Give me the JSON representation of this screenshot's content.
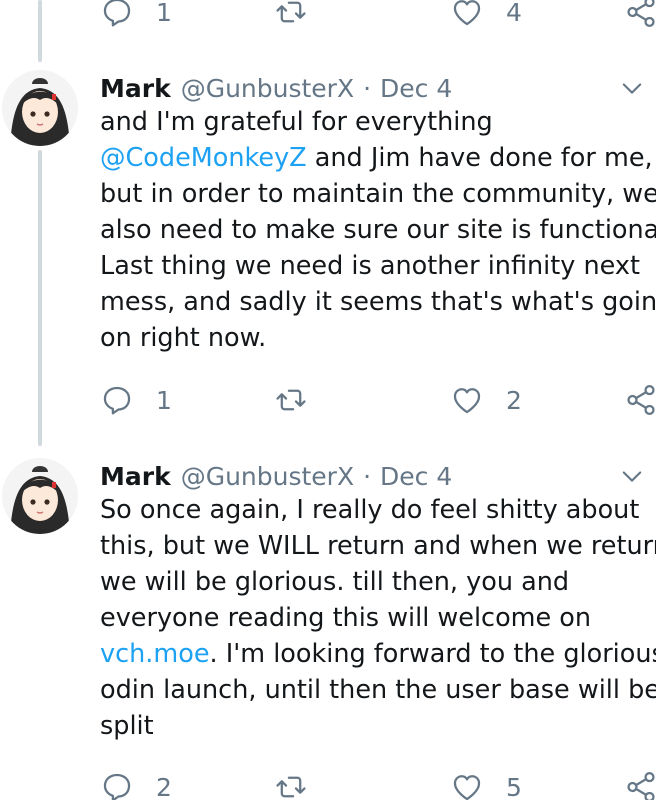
{
  "top_actions": {
    "reply_count": "1",
    "like_count": "4"
  },
  "tweets": [
    {
      "name": "Mark",
      "handle": "@GunbusterX",
      "separator": "·",
      "date": "Dec 4",
      "lines": [
        [
          {
            "text": "and I'm grateful for everything",
            "type": "text"
          }
        ],
        [
          {
            "text": "@CodeMonkeyZ",
            "type": "link"
          },
          {
            "text": " and Jim have done for me,",
            "type": "text"
          }
        ],
        [
          {
            "text": "but in order to maintain the community, we",
            "type": "text"
          }
        ],
        [
          {
            "text": "also need to make sure our site is functional.",
            "type": "text"
          }
        ],
        [
          {
            "text": "Last thing we need is another infinity next",
            "type": "text"
          }
        ],
        [
          {
            "text": "mess, and sadly it seems that's what's going",
            "type": "text"
          }
        ],
        [
          {
            "text": "on right now.",
            "type": "text"
          }
        ]
      ],
      "reply_count": "1",
      "like_count": "2"
    },
    {
      "name": "Mark",
      "handle": "@GunbusterX",
      "separator": "·",
      "date": "Dec 4",
      "lines": [
        [
          {
            "text": "So once again, I really do feel shitty about",
            "type": "text"
          }
        ],
        [
          {
            "text": "this, but we WILL return and when we return",
            "type": "text"
          }
        ],
        [
          {
            "text": "we will be glorious. till then, you and",
            "type": "text"
          }
        ],
        [
          {
            "text": "everyone reading this will welcome on",
            "type": "text"
          }
        ],
        [
          {
            "text": "vch.moe",
            "type": "link"
          },
          {
            "text": ". I'm looking forward to the glorious",
            "type": "text"
          }
        ],
        [
          {
            "text": "odin launch, until then the user base will be",
            "type": "text"
          }
        ],
        [
          {
            "text": "split",
            "type": "text"
          }
        ]
      ],
      "reply_count": "2",
      "like_count": "5"
    }
  ],
  "icons": {
    "reply": "reply-icon",
    "retweet": "retweet-icon",
    "like": "heart-icon",
    "share": "share-icon",
    "more": "chevron-down-icon"
  },
  "colors": {
    "link": "#1da1f2",
    "muted": "#657786",
    "text": "#14171a",
    "thread_line": "#cfd9de"
  }
}
